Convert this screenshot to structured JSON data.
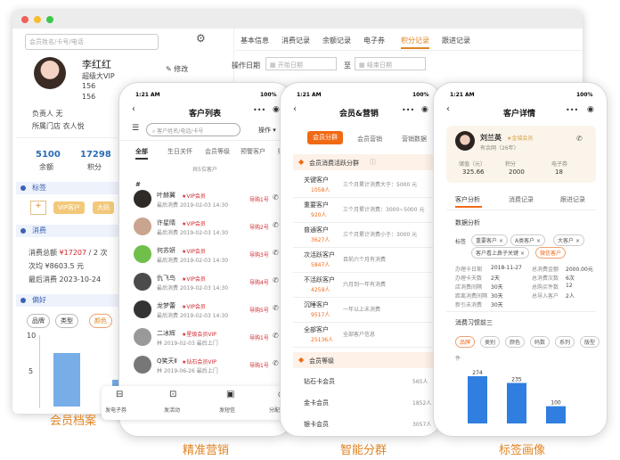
{
  "captions": {
    "c1": "会员档案",
    "c2": "精准营销",
    "c3": "智能分群",
    "c4": "标签画像"
  },
  "desktop": {
    "search_placeholder": "会员姓名/卡号/电话",
    "tabs": [
      "基本信息",
      "消费记录",
      "余额记录",
      "电子券",
      "积分记录",
      "跟进记录"
    ],
    "date_label": "操作日期",
    "date_start": "开始日期",
    "date_sep": "至",
    "date_end": "结束日期",
    "name": "李红红",
    "level": "超级大VIP",
    "phone_masked": "156",
    "phone2_masked": "156",
    "edit": "修改",
    "owner_label": "负责人",
    "owner": "无",
    "store_label": "所属门店",
    "store": "衣人悦",
    "balance_value": "5100",
    "balance_label": "余额",
    "points_value": "17298",
    "points_label": "积分",
    "tags_title": "标签",
    "tag_add": "+",
    "tag1": "VIP客户",
    "tag2": "大码",
    "consume_title": "消费",
    "total_label": "消费总额",
    "total_value": "¥17207",
    "total_count": "/ 2 次",
    "avg_label": "次均",
    "avg_value": "¥8603.5 元",
    "last_label": "最后消费",
    "last_value": "2023-10-24",
    "pref_title": "偏好",
    "pref_chips": [
      "品牌",
      "类型",
      "颜色"
    ],
    "chart_ticks": [
      "10",
      "5"
    ],
    "accent": "#f06a16",
    "blue": "#2b6db3"
  },
  "phone1": {
    "time": "1:21 AM",
    "battery": "100%",
    "title": "客户列表",
    "search_placeholder": "客户姓名/电话/卡号",
    "operate": "操作",
    "tabs": [
      "全部",
      "生日关怀",
      "会员等级",
      "预警客户",
      "购"
    ],
    "count_text": "共5位客户",
    "section": "#",
    "customers": [
      {
        "name": "叶赫翼",
        "vip": "VIP会员",
        "last": "最后消费",
        "date": "2019-02-03 14:30",
        "tag": "导购1号"
      },
      {
        "name": "许星晴",
        "vip": "VIP会员",
        "last": "最后消费",
        "date": "2019-02-03 14:30",
        "tag": "导购2号"
      },
      {
        "name": "何苏妍",
        "vip": "VIP会员",
        "last": "最后消费",
        "date": "2019-02-03 14:30",
        "tag": "导购3号"
      },
      {
        "name": "仇飞鸟",
        "vip": "VIP会员",
        "last": "最后消费",
        "date": "2019-02-03 14:30",
        "tag": "导购4号"
      },
      {
        "name": "龙梦蕾",
        "vip": "VIP会员",
        "last": "最后消费",
        "date": "2019-02-03 14:30",
        "tag": "导购5号"
      },
      {
        "name": "二冰辉",
        "vip": "星级会员VIP",
        "last": "林",
        "date": "2019-02-03",
        "tag": "导购1号"
      },
      {
        "name": "Q笑天Ⅱ",
        "vip": "钻石会员VIP",
        "last": "林",
        "date": "2019-06-26",
        "tag": "导购1号"
      }
    ],
    "row_extra": "最后上门",
    "actions": [
      "发电子券",
      "发活动",
      "发短信",
      "分配客户"
    ]
  },
  "phone2": {
    "time": "1:21 AM",
    "battery": "100%",
    "title": "会员&营销",
    "tabs": [
      "会员分群",
      "会员营销",
      "营销数据"
    ],
    "group_title": "会员消费活跃分群",
    "groups": [
      {
        "name": "关键客户",
        "count": "1058人",
        "desc": "三个月累计消费大于：5000 元"
      },
      {
        "name": "重要客户",
        "count": "920人",
        "desc": "三个月累计消费：3000~5000 元"
      },
      {
        "name": "普通客户",
        "count": "3627人",
        "desc": "三个月累计消费小于：3000 元"
      },
      {
        "name": "次活跃客户",
        "count": "5847人",
        "desc": "目前六个月有消费"
      },
      {
        "name": "不活跃客户",
        "count": "4259人",
        "desc": "六月到一年有消费"
      },
      {
        "name": "沉睡客户",
        "count": "9517人",
        "desc": "一年以上未消费"
      },
      {
        "name": "全部客户",
        "count": "25136人",
        "desc": "全部客户信息"
      }
    ],
    "level_title": "会员等级",
    "levels": [
      {
        "name": "钻石卡会员",
        "count": "565人"
      },
      {
        "name": "金卡会员",
        "count": "1852人"
      },
      {
        "name": "银卡会员",
        "count": "3057人"
      }
    ]
  },
  "phone3": {
    "time": "1:21 AM",
    "battery": "100%",
    "title": "客户详情",
    "name": "刘兰英",
    "badge": "金域会员",
    "sub": "有余网（26年）",
    "stats": [
      {
        "label": "储值（元）",
        "value": "325.66"
      },
      {
        "label": "积分",
        "value": "2000"
      },
      {
        "label": "电子券",
        "value": "18"
      }
    ],
    "tabs": [
      "客户分析",
      "消费记录",
      "跟进记录"
    ],
    "analysis_title": "数据分析",
    "tags_label": "标签",
    "tags": [
      "重要客户",
      "A类客户",
      "大客户",
      "客户看上鼻子关键",
      "微信客户"
    ],
    "details": [
      {
        "k1": "办理卡日期",
        "v1": "2018-11-27",
        "k2": "总消费金额",
        "v2": "2000.00元"
      },
      {
        "k1": "办理卡天数",
        "v1": "2天",
        "k2": "总消费次数",
        "v2": "6次"
      },
      {
        "k1": "店消费间隔",
        "v1": "30天",
        "k2": "总购买件数",
        "v2": "12"
      },
      {
        "k1": "距离消费间隔",
        "v1": "30天",
        "k2": "总导入客户",
        "v2": "2人"
      },
      {
        "k1": "新引未消费",
        "v1": "30天",
        "k2": "",
        "v2": ""
      }
    ],
    "habit_title": "消费习惯前三",
    "habit_chips": [
      "品牌",
      "类别",
      "颜色",
      "码数",
      "系列",
      "版型"
    ],
    "chart_unit": "件",
    "chart_data": {
      "type": "bar",
      "values": [
        274,
        235,
        100
      ],
      "ylabel": "件"
    }
  }
}
